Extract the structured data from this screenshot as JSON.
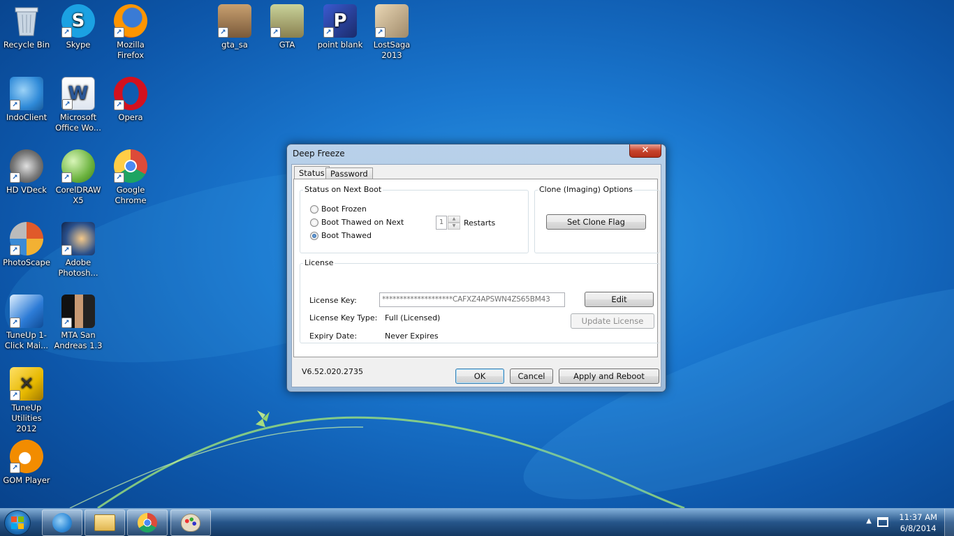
{
  "desktop": {
    "icons": [
      {
        "label": "Recycle Bin",
        "icon": "recycle-bin-icon",
        "color": "#9fb3c8"
      },
      {
        "label": "Skype",
        "icon": "skype-icon",
        "color": "#1ba1e2"
      },
      {
        "label": "Mozilla Firefox",
        "icon": "firefox-icon",
        "color": "#e66000"
      },
      {
        "label": "gta_sa",
        "icon": "gta-sa-icon",
        "color": "#7a5a3a"
      },
      {
        "label": "GTA",
        "icon": "gta-icon",
        "color": "#8a8050"
      },
      {
        "label": "point blank",
        "icon": "point-blank-icon",
        "color": "#1b2b6b"
      },
      {
        "label": "LostSaga 2013",
        "icon": "lostsaga-icon",
        "color": "#a08a6a"
      },
      {
        "label": "IndoClient",
        "icon": "indoclient-icon",
        "color": "#2f8ad8"
      },
      {
        "label": "Microsoft Office Wo...",
        "icon": "word-icon",
        "color": "#2b5797"
      },
      {
        "label": "Opera",
        "icon": "opera-icon",
        "color": "#d3111e"
      },
      {
        "label": "HD VDeck",
        "icon": "hd-vdeck-icon",
        "color": "#5a5a5a"
      },
      {
        "label": "CorelDRAW X5",
        "icon": "coreldraw-icon",
        "color": "#6cb33f"
      },
      {
        "label": "Google Chrome",
        "icon": "chrome-icon",
        "color": "#dd4b39"
      },
      {
        "label": "PhotoScape",
        "icon": "photoscape-icon",
        "color": "#e05a2a"
      },
      {
        "label": "Adobe Photosh...",
        "icon": "photoshop-icon",
        "color": "#2a4f8a"
      },
      {
        "label": "TuneUp 1-Click Mai...",
        "icon": "tuneup-1click-icon",
        "color": "#2c7bd6"
      },
      {
        "label": "MTA San Andreas 1.3",
        "icon": "mta-icon",
        "color": "#3a3a3a"
      },
      {
        "label": "TuneUp Utilities 2012",
        "icon": "tuneup-utilities-icon",
        "color": "#e6b800"
      },
      {
        "label": "GOM Player",
        "icon": "gom-player-icon",
        "color": "#f28c00"
      }
    ]
  },
  "dialog": {
    "title": "Deep Freeze",
    "close_glyph": "✕",
    "tabs": [
      {
        "label": "Status"
      },
      {
        "label": "Password"
      }
    ],
    "boot_group": {
      "label": "Status on Next Boot",
      "options": [
        {
          "label": "Boot Frozen",
          "checked": false
        },
        {
          "label": "Boot Thawed on Next",
          "checked": false
        },
        {
          "label": "Boot Thawed",
          "checked": true
        }
      ],
      "restarts_value": "1",
      "restarts_label": "Restarts"
    },
    "clone_group": {
      "label": "Clone (Imaging) Options",
      "button": "Set Clone Flag"
    },
    "license_group": {
      "label": "License",
      "key_label": "License Key:",
      "key_value": "********************CAFXZ4APSWN4ZS65BM43",
      "type_label": "License Key Type:",
      "type_value": "Full (Licensed)",
      "expiry_label": "Expiry Date:",
      "expiry_value": "Never Expires",
      "edit_button": "Edit",
      "update_button": "Update License"
    },
    "version": "V6.52.020.2735",
    "ok_button": "OK",
    "cancel_button": "Cancel",
    "apply_button": "Apply and Reboot"
  },
  "taskbar": {
    "pinned": [
      {
        "icon": "indoclient-icon"
      },
      {
        "icon": "file-explorer-icon"
      },
      {
        "icon": "chrome-icon"
      },
      {
        "icon": "paint-icon"
      }
    ],
    "time": "11:37 AM",
    "date": "6/8/2014"
  }
}
